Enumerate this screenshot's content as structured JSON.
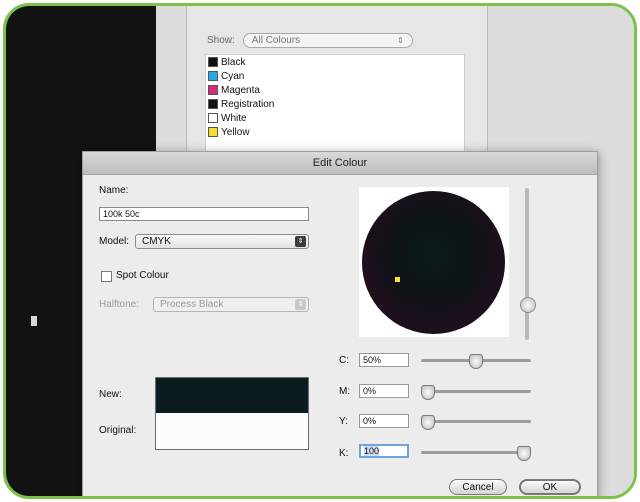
{
  "colours_window": {
    "show_label": "Show:",
    "show_value": "All Colours",
    "items": [
      {
        "label": "Black",
        "color": "#111111"
      },
      {
        "label": "Cyan",
        "color": "#25a9e0"
      },
      {
        "label": "Magenta",
        "color": "#d62b7a"
      },
      {
        "label": "Registration",
        "color": "#111111"
      },
      {
        "label": "White",
        "color": "#ffffff"
      },
      {
        "label": "Yellow",
        "color": "#f3e228"
      }
    ]
  },
  "dialog": {
    "title": "Edit Colour",
    "name_label": "Name:",
    "name_value": "100k 50c",
    "model_label": "Model:",
    "model_value": "CMYK",
    "spot_colour_label": "Spot Colour",
    "halftone_label": "Halftone:",
    "halftone_value": "Process Black",
    "new_label": "New:",
    "original_label": "Original:",
    "channels": [
      {
        "label": "C:",
        "value": "50%",
        "level": 0.5
      },
      {
        "label": "M:",
        "value": "0%",
        "level": 0.0
      },
      {
        "label": "Y:",
        "value": "0%",
        "level": 0.0
      },
      {
        "label": "K:",
        "value": "100",
        "level": 1.0
      }
    ],
    "cancel_label": "Cancel",
    "ok_label": "OK"
  },
  "colors": {
    "frame_accent": "#7cc24a",
    "new_colour": "#0b1c1e",
    "original_colour": "#fbfbfb"
  }
}
